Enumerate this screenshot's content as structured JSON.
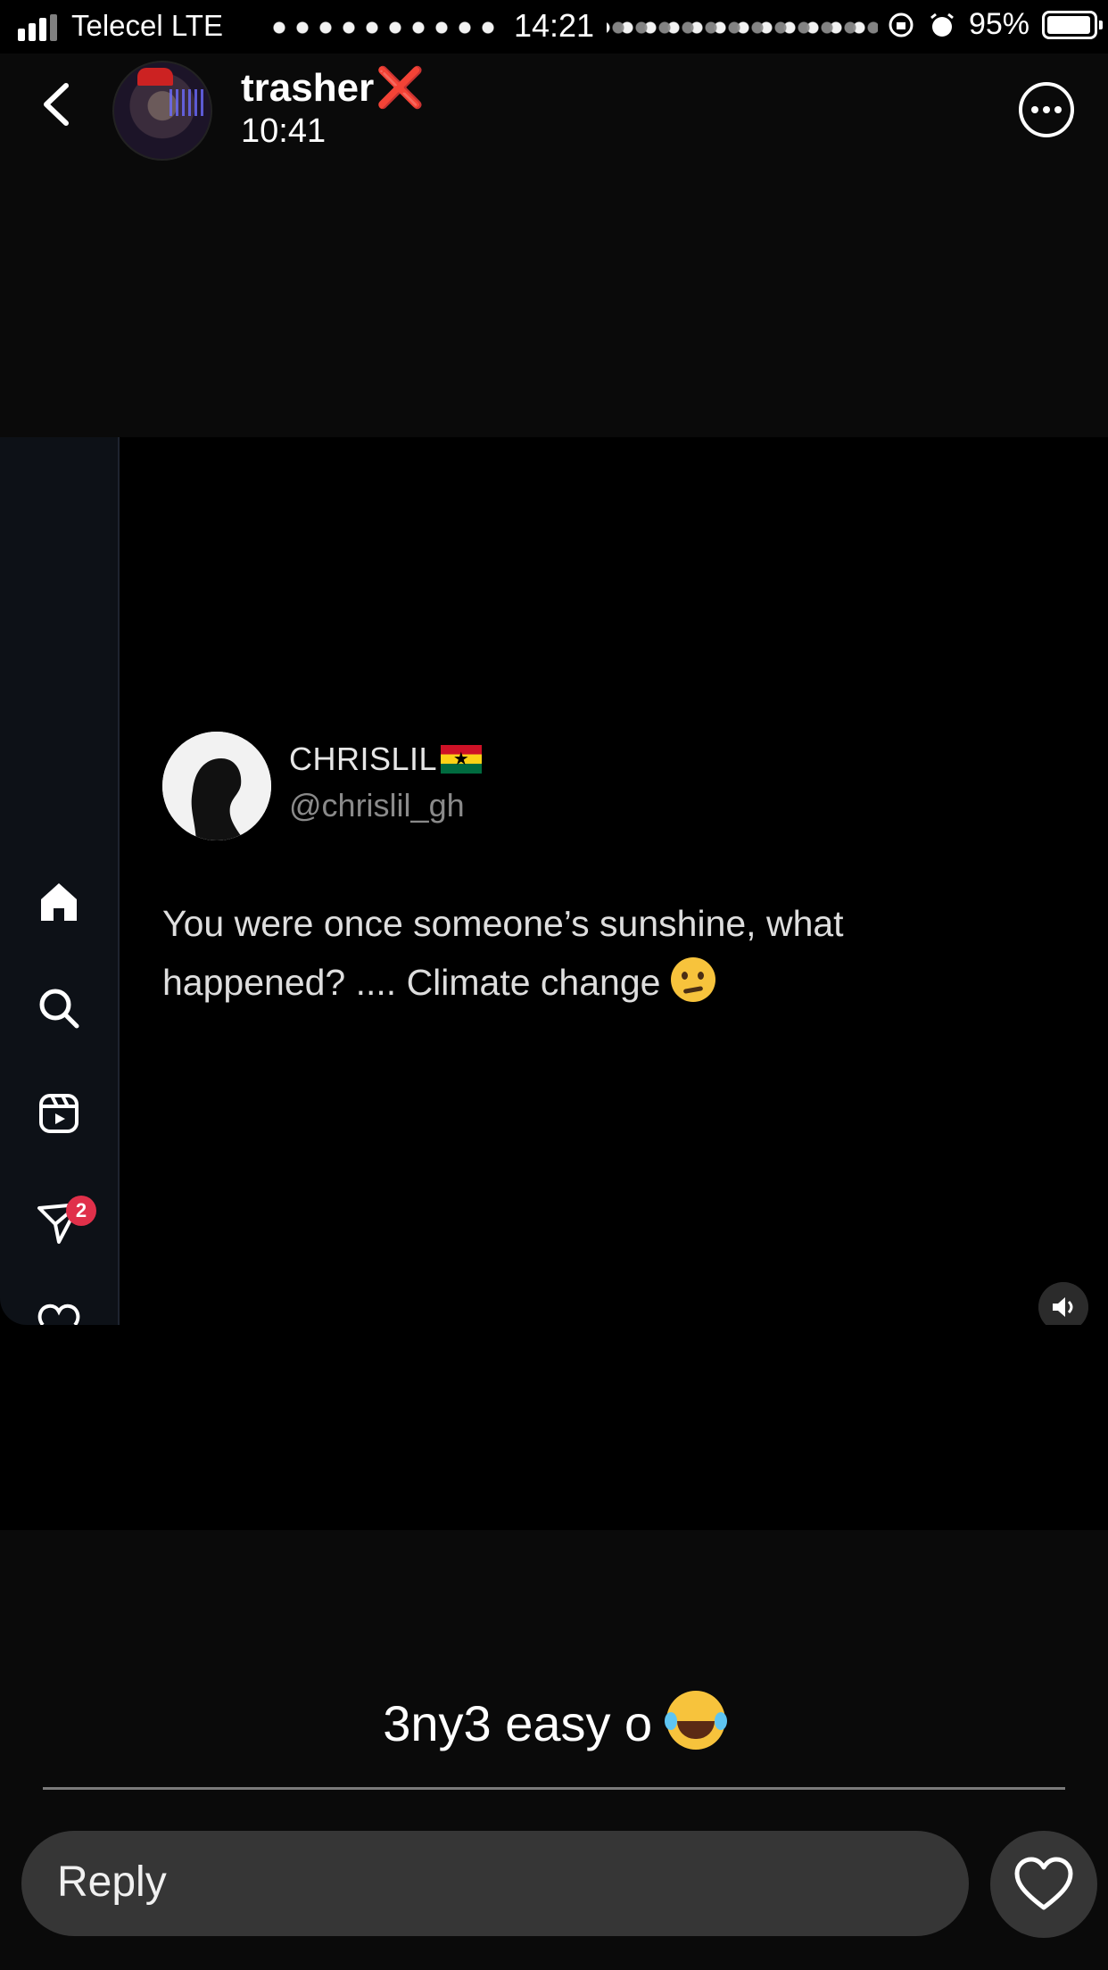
{
  "status_bar": {
    "carrier": "Telecel LTE",
    "time": "14:21",
    "battery_percent": "95%"
  },
  "story_header": {
    "username": "trasher",
    "username_suffix": "❌",
    "posted_time": "10:41"
  },
  "embedded_post": {
    "sidebar_icons": [
      "home-icon",
      "search-icon",
      "reels-icon",
      "messages-icon",
      "heart-icon"
    ],
    "messages_badge": "2",
    "author_name": "CHRISLIL",
    "author_handle": "@chrislil_gh",
    "text_line1": "You were once someone’s sunshine, what",
    "text_line2": "happened? .... Climate change",
    "flag_colors": [
      "#ce1126",
      "#fcd116",
      "#006b3f"
    ]
  },
  "caption": {
    "text": "3ny3 easy o"
  },
  "reply_bar": {
    "placeholder": "Reply"
  },
  "colors": {
    "background": "#000000",
    "header_bg": "#0a0a0a",
    "reply_bg": "#363636",
    "badge": "#e0304a"
  }
}
